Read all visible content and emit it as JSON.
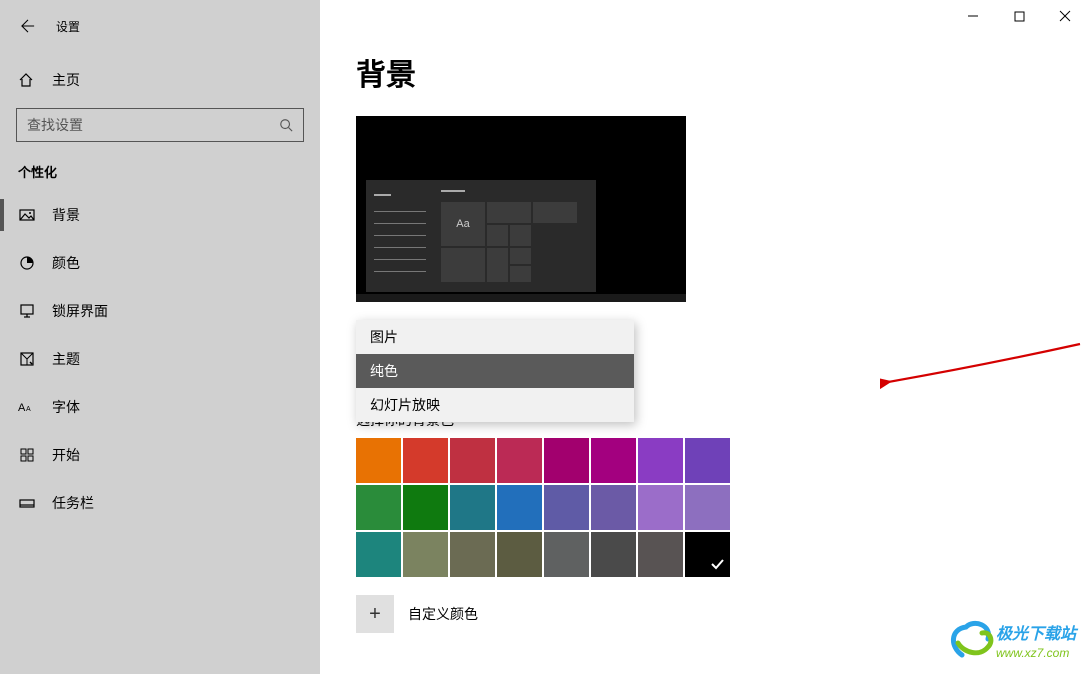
{
  "app_title": "设置",
  "home_label": "主页",
  "search_placeholder": "查找设置",
  "section_title": "个性化",
  "nav": [
    {
      "label": "背景"
    },
    {
      "label": "颜色"
    },
    {
      "label": "锁屏界面"
    },
    {
      "label": "主题"
    },
    {
      "label": "字体"
    },
    {
      "label": "开始"
    },
    {
      "label": "任务栏"
    }
  ],
  "page_title": "背景",
  "preview_sample": "Aa",
  "dropdown_options": [
    {
      "label": "图片"
    },
    {
      "label": "纯色"
    },
    {
      "label": "幻灯片放映"
    }
  ],
  "color_section_label": "选择你的背景色",
  "colors": [
    "#e87203",
    "#d43a2b",
    "#bf3041",
    "#bb2a55",
    "#a2006e",
    "#a3007f",
    "#8a3cc3",
    "#6f41b8",
    "#2a8c3a",
    "#0f7a0f",
    "#1f7787",
    "#226fbb",
    "#5f5ba6",
    "#6b5aa6",
    "#9b6dc9",
    "#8d6fbf",
    "#1d857d",
    "#7b8360",
    "#6b6b53",
    "#5c5c41",
    "#5f6161",
    "#4a4a4a",
    "#585353",
    "#000000"
  ],
  "selected_color_index": 23,
  "custom_color_label": "自定义颜色",
  "watermark": {
    "line1": "极光下载站",
    "line2": "www.xz7.com"
  }
}
